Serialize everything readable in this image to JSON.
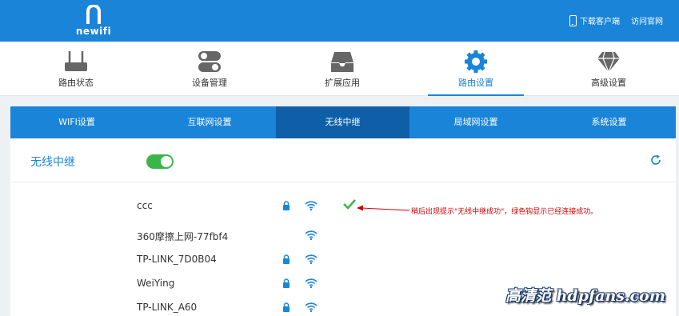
{
  "header": {
    "brand": "newifi",
    "download_link": "下载客户端",
    "website_link": "访问官网"
  },
  "topnav": [
    {
      "label": "路由状态",
      "icon": "router-icon"
    },
    {
      "label": "设备管理",
      "icon": "toggle-switch-icon"
    },
    {
      "label": "扩展应用",
      "icon": "tray-icon"
    },
    {
      "label": "路由设置",
      "icon": "gear-icon",
      "active": true
    },
    {
      "label": "高级设置",
      "icon": "diamond-icon"
    }
  ],
  "subtabs": [
    {
      "label": "WIFI设置"
    },
    {
      "label": "互联网设置"
    },
    {
      "label": "无线中继",
      "active": true
    },
    {
      "label": "局域网设置"
    },
    {
      "label": "系统设置"
    }
  ],
  "section": {
    "title": "无线中继",
    "toggle_on": true
  },
  "networks": [
    {
      "name": "ccc",
      "locked": true,
      "connected": true
    },
    {
      "name": "360摩擦上网-77fbf4",
      "locked": false,
      "connected": false
    },
    {
      "name": "TP-LINK_7D0B04",
      "locked": true,
      "connected": false
    },
    {
      "name": "WeiYing",
      "locked": true,
      "connected": false
    },
    {
      "name": "TP-LINK_A60",
      "locked": true,
      "connected": false
    }
  ],
  "annotation": "稍后出现提示\"无线中继成功\"，绿色钩显示已经连接成功。",
  "watermark": "高清范 hdpfans.com",
  "colors": {
    "primary": "#1a84d8",
    "active_tab": "#0f5fa8",
    "toggle_on": "#3bb54a",
    "annotation": "#cc0000"
  }
}
